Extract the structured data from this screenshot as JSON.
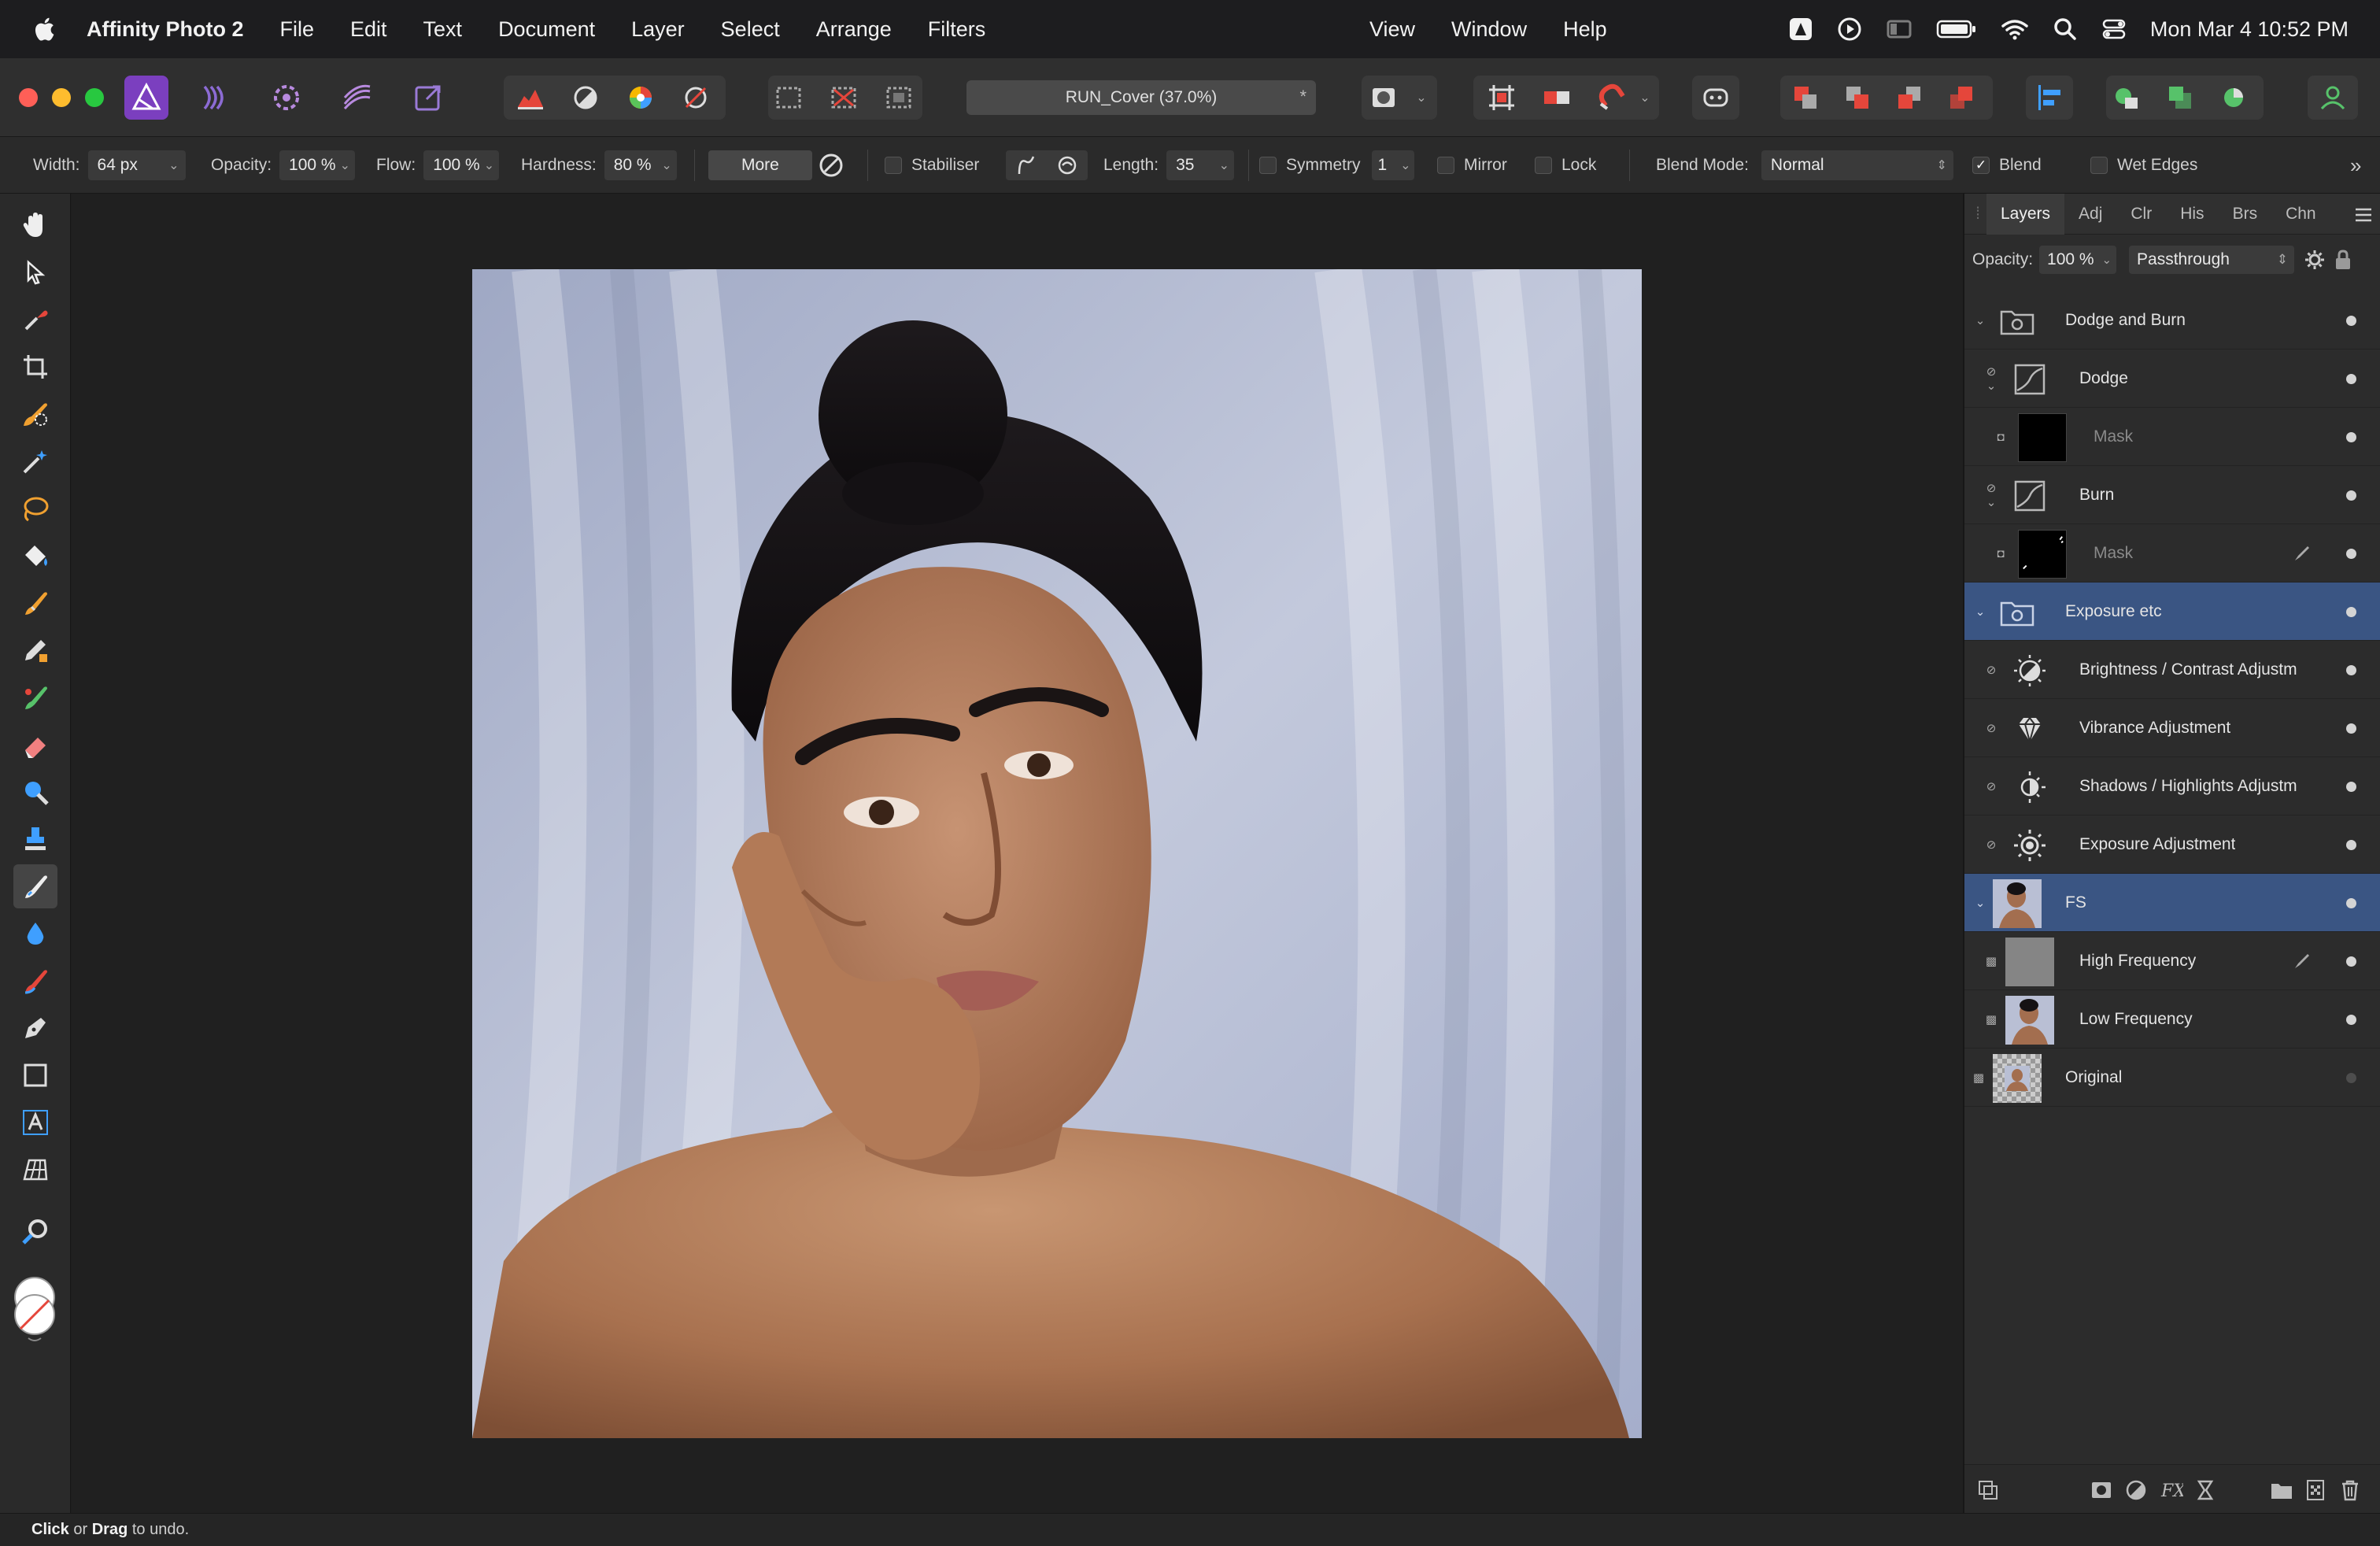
{
  "menubar": {
    "app_name": "Affinity Photo 2",
    "menus": [
      "File",
      "Edit",
      "Text",
      "Document",
      "Layer",
      "Select",
      "Arrange",
      "Filters"
    ],
    "right_menus": [
      "View",
      "Window",
      "Help"
    ],
    "clock": "Mon Mar 4  10:52 PM"
  },
  "toolbar": {
    "document_tab": "RUN_Cover (37.0%)",
    "document_star": "*"
  },
  "context_toolbar": {
    "width_label": "Width:",
    "width_value": "64 px",
    "opacity_label": "Opacity:",
    "opacity_value": "100 %",
    "flow_label": "Flow:",
    "flow_value": "100 %",
    "hardness_label": "Hardness:",
    "hardness_value": "80 %",
    "more_button": "More",
    "stabiliser_label": "Stabiliser",
    "length_label": "Length:",
    "length_value": "35",
    "symmetry_label": "Symmetry",
    "symmetry_value": "1",
    "mirror_label": "Mirror",
    "lock_label": "Lock",
    "blend_mode_label": "Blend Mode:",
    "blend_mode_value": "Normal",
    "blend_label": "Blend",
    "wet_edges_label": "Wet Edges"
  },
  "layers_panel": {
    "tabs": [
      "Layers",
      "Adj",
      "Clr",
      "His",
      "Brs",
      "Chn"
    ],
    "opacity_label": "Opacity:",
    "opacity_value": "100 %",
    "blend_mode": "Passthrough",
    "layers": [
      {
        "name": "Dodge and Burn",
        "type": "group",
        "level": 0,
        "expanded": true,
        "selected": false,
        "visible": true
      },
      {
        "name": "Dodge",
        "type": "curves",
        "level": 1,
        "expanded": true,
        "selected": false,
        "visible": true
      },
      {
        "name": "Mask",
        "type": "mask-black",
        "level": 2,
        "selected": false,
        "visible": true
      },
      {
        "name": "Burn",
        "type": "curves",
        "level": 1,
        "expanded": true,
        "selected": false,
        "visible": true
      },
      {
        "name": "Mask",
        "type": "mask-black-marks",
        "level": 2,
        "selected": false,
        "visible": true,
        "brush": true
      },
      {
        "name": "Exposure etc",
        "type": "group",
        "level": 0,
        "expanded": true,
        "selected": true,
        "visible": true
      },
      {
        "name": "Brightness / Contrast Adjustm",
        "type": "brightness",
        "level": 1,
        "selected": false,
        "visible": true
      },
      {
        "name": "Vibrance Adjustment",
        "type": "vibrance",
        "level": 1,
        "selected": false,
        "visible": true
      },
      {
        "name": "Shadows / Highlights Adjustm",
        "type": "shadows",
        "level": 1,
        "selected": false,
        "visible": true
      },
      {
        "name": "Exposure Adjustment",
        "type": "exposure",
        "level": 1,
        "selected": false,
        "visible": true
      },
      {
        "name": "FS",
        "type": "photo-group",
        "level": 0,
        "expanded": true,
        "selected": true,
        "visible": true
      },
      {
        "name": "High Frequency",
        "type": "gray",
        "level": 1,
        "selected": false,
        "visible": true,
        "brush": true
      },
      {
        "name": "Low Frequency",
        "type": "photo",
        "level": 1,
        "selected": false,
        "visible": true
      },
      {
        "name": "Original",
        "type": "photo-checker",
        "level": 0,
        "selected": false,
        "visible": false
      }
    ]
  },
  "statusbar": {
    "click": "Click",
    "or": " or ",
    "drag": "Drag",
    "rest": " to undo."
  },
  "colors": {
    "accent_purple": "#7b3fbf",
    "selection_blue": "#3a5583",
    "backdrop": "#b9bfd4"
  }
}
